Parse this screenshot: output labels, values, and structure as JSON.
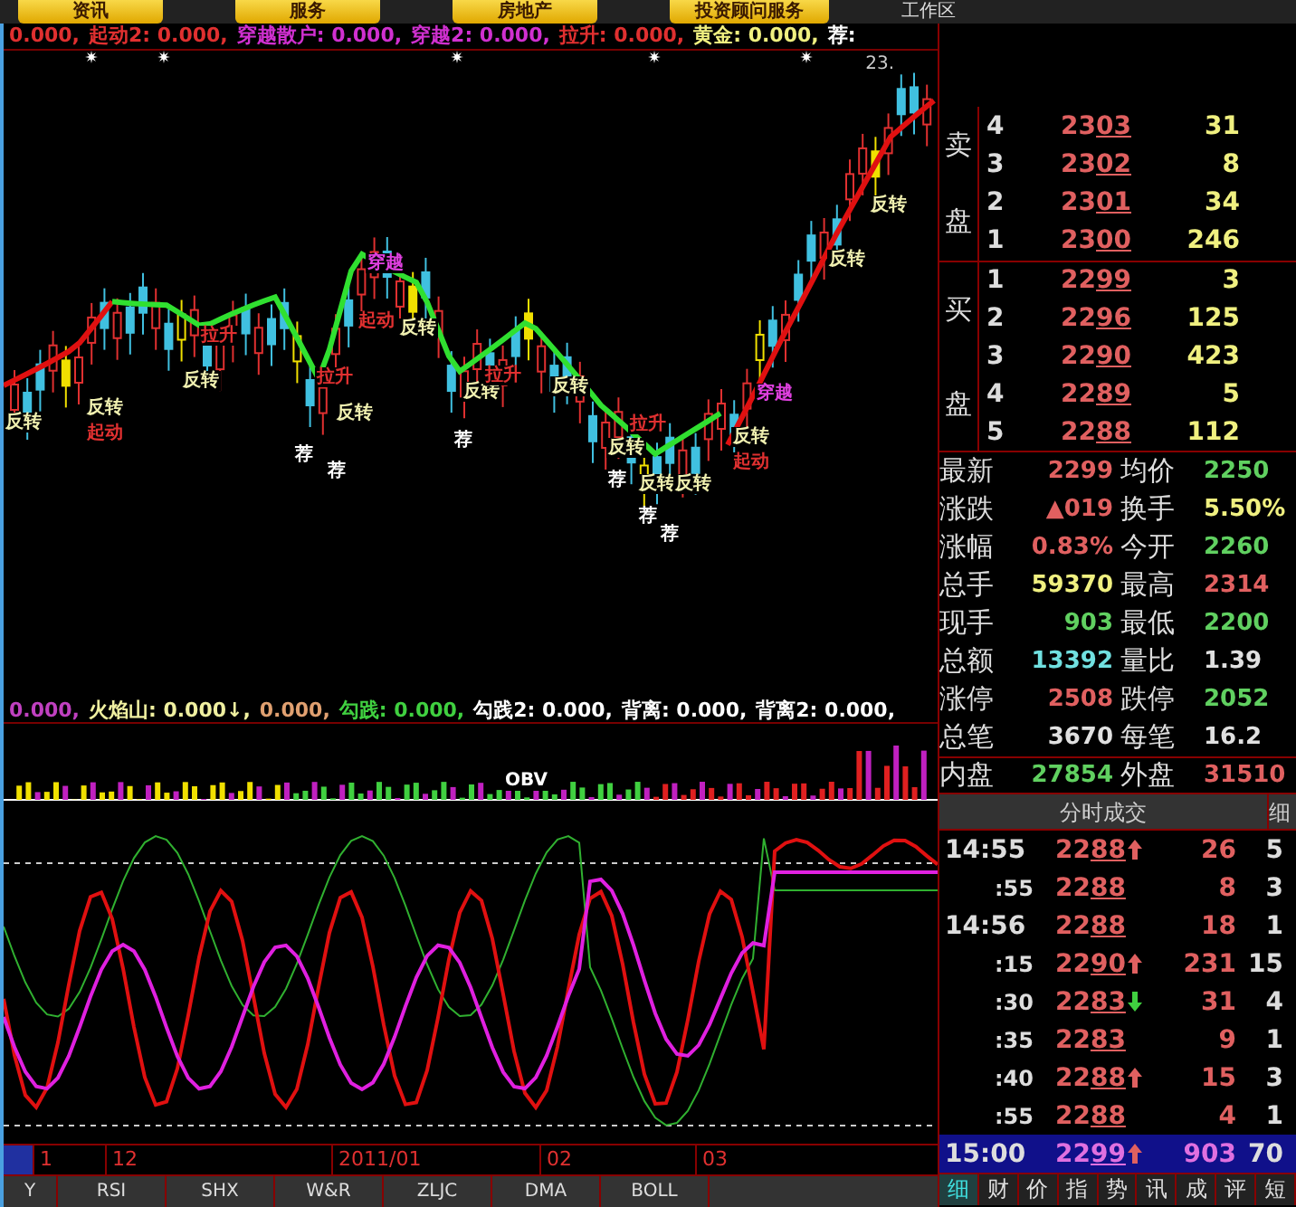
{
  "top_menu": [
    {
      "label": "资讯"
    },
    {
      "label": "服务"
    },
    {
      "label": "房地产"
    },
    {
      "label": "投资顾问服务"
    }
  ],
  "workspace": {
    "label": "工作区"
  },
  "main_legend": [
    {
      "text": "0.000,",
      "color": "#e03030"
    },
    {
      "text": "起动2: 0.000,",
      "color": "#e03030"
    },
    {
      "text": "穿越散户: 0.000,",
      "color": "#d030d0"
    },
    {
      "text": "穿越2: 0.000,",
      "color": "#d030d0"
    },
    {
      "text": "拉升: 0.000,",
      "color": "#e03030"
    },
    {
      "text": "黄金: 0.000,",
      "color": "#f0f080"
    },
    {
      "text": "荐:",
      "color": "#ffffff"
    }
  ],
  "price_tick": "23.",
  "chart_labels": [
    {
      "text": "反转",
      "color": "#f0f0b0"
    },
    {
      "text": "反转",
      "color": "#f0f0b0"
    },
    {
      "text": "起动",
      "color": "#e03030"
    },
    {
      "text": "拉升",
      "color": "#e03030"
    },
    {
      "text": "反转",
      "color": "#f0f0b0"
    },
    {
      "text": "拉升",
      "color": "#e03030"
    },
    {
      "text": "反转",
      "color": "#f0f0b0"
    },
    {
      "text": "荐",
      "color": "#ffffff"
    },
    {
      "text": "荐",
      "color": "#ffffff"
    },
    {
      "text": "穿越",
      "color": "#e040e0"
    },
    {
      "text": "起动",
      "color": "#e03030"
    },
    {
      "text": "反转",
      "color": "#f0f0b0"
    },
    {
      "text": "荐",
      "color": "#ffffff"
    },
    {
      "text": "反转",
      "color": "#f0f0b0"
    },
    {
      "text": "拉升",
      "color": "#e03030"
    },
    {
      "text": "反转",
      "color": "#f0f0b0"
    },
    {
      "text": "拉升",
      "color": "#e03030"
    },
    {
      "text": "反转",
      "color": "#f0f0b0"
    },
    {
      "text": "荐",
      "color": "#ffffff"
    },
    {
      "text": "反转",
      "color": "#f0f0b0"
    },
    {
      "text": "反转",
      "color": "#f0f0b0"
    },
    {
      "text": "荐",
      "color": "#ffffff"
    },
    {
      "text": "荐",
      "color": "#ffffff"
    },
    {
      "text": "反转",
      "color": "#f0f0b0"
    },
    {
      "text": "起动",
      "color": "#e03030"
    },
    {
      "text": "穿越",
      "color": "#e040e0"
    },
    {
      "text": "反转",
      "color": "#f0f0b0"
    },
    {
      "text": "反转",
      "color": "#f0f0b0"
    }
  ],
  "sub_legend": [
    {
      "text": "0.000,",
      "color": "#c040c0"
    },
    {
      "text": "火焰山: 0.000↓,",
      "color": "#f0f0a0"
    },
    {
      "text": "0.000,",
      "color": "#e0a070"
    },
    {
      "text": "勾践: 0.000,",
      "color": "#40d040"
    },
    {
      "text": "勾践2: 0.000,",
      "color": "#ffffff"
    },
    {
      "text": "背离: 0.000,",
      "color": "#ffffff"
    },
    {
      "text": "背离2: 0.000,",
      "color": "#ffffff"
    }
  ],
  "sub_chart_label": "OBV",
  "date_axis": [
    "1",
    "12",
    "2011/01",
    "02",
    "03"
  ],
  "indicator_tabs": [
    {
      "label": "Y"
    },
    {
      "label": "RSI"
    },
    {
      "label": "SHX"
    },
    {
      "label": "W&R"
    },
    {
      "label": "ZLJC"
    },
    {
      "label": "DMA"
    },
    {
      "label": "BOLL"
    }
  ],
  "order_book": {
    "sell_label": [
      "卖",
      "盘"
    ],
    "buy_label": [
      "买",
      "盘"
    ],
    "sell": [
      {
        "level": "4",
        "price": "2303",
        "volume": "31"
      },
      {
        "level": "3",
        "price": "2302",
        "volume": "8"
      },
      {
        "level": "2",
        "price": "2301",
        "volume": "34"
      },
      {
        "level": "1",
        "price": "2300",
        "volume": "246"
      }
    ],
    "buy": [
      {
        "level": "1",
        "price": "2299",
        "volume": "3"
      },
      {
        "level": "2",
        "price": "2296",
        "volume": "125"
      },
      {
        "level": "3",
        "price": "2290",
        "volume": "423"
      },
      {
        "level": "4",
        "price": "2289",
        "volume": "5"
      },
      {
        "level": "5",
        "price": "2288",
        "volume": "112"
      }
    ]
  },
  "stats": [
    [
      {
        "label": "最新",
        "value": "2299",
        "color": "#e06060"
      },
      {
        "label": "均价",
        "value": "2250",
        "color": "#60d060"
      }
    ],
    [
      {
        "label": "涨跌",
        "value": "▲019",
        "color": "#e06060"
      },
      {
        "label": "换手",
        "value": "5.50%",
        "color": "#f0f080"
      }
    ],
    [
      {
        "label": "涨幅",
        "value": "0.83%",
        "color": "#e06060"
      },
      {
        "label": "今开",
        "value": "2260",
        "color": "#60d060"
      }
    ],
    [
      {
        "label": "总手",
        "value": "59370",
        "color": "#f0f080"
      },
      {
        "label": "最高",
        "value": "2314",
        "color": "#e06060"
      }
    ],
    [
      {
        "label": "现手",
        "value": "903",
        "color": "#60d060"
      },
      {
        "label": "最低",
        "value": "2200",
        "color": "#60d060"
      }
    ],
    [
      {
        "label": "总额",
        "value": "13392",
        "color": "#70e0e0"
      },
      {
        "label": "量比",
        "value": "1.39",
        "color": "#e0e0e0"
      }
    ],
    [
      {
        "label": "涨停",
        "value": "2508",
        "color": "#e06060"
      },
      {
        "label": "跌停",
        "value": "2052",
        "color": "#60d060"
      }
    ],
    [
      {
        "label": "总笔",
        "value": "3670",
        "color": "#e0e0e0"
      },
      {
        "label": "每笔",
        "value": "16.2",
        "color": "#e0e0e0"
      }
    ],
    [
      {
        "label": "内盘",
        "value": "27854",
        "color": "#60d060"
      },
      {
        "label": "外盘",
        "value": "31510",
        "color": "#e06060"
      }
    ]
  ],
  "trades_header": {
    "title": "分时成交",
    "tab": "细"
  },
  "trades": [
    {
      "time": "14:55",
      "price": "2288",
      "kind": "up",
      "volume": "26",
      "count": "5",
      "selected": false
    },
    {
      "time": ":55",
      "price": "2288",
      "kind": "none",
      "volume": "8",
      "count": "3",
      "selected": false
    },
    {
      "time": "14:56",
      "price": "2288",
      "kind": "none",
      "volume": "18",
      "count": "1",
      "selected": false
    },
    {
      "time": ":15",
      "price": "2290",
      "kind": "up",
      "volume": "231",
      "count": "15",
      "selected": false
    },
    {
      "time": ":30",
      "price": "2283",
      "kind": "down",
      "volume": "31",
      "count": "4",
      "selected": false
    },
    {
      "time": ":35",
      "price": "2283",
      "kind": "none",
      "volume": "9",
      "count": "1",
      "selected": false
    },
    {
      "time": ":40",
      "price": "2288",
      "kind": "up",
      "volume": "15",
      "count": "3",
      "selected": false
    },
    {
      "time": ":55",
      "price": "2288",
      "kind": "none",
      "volume": "4",
      "count": "1",
      "selected": false
    },
    {
      "time": "15:00",
      "price": "2299",
      "kind": "up",
      "volume": "903",
      "count": "70",
      "selected": true
    }
  ],
  "bottom_tabs": [
    {
      "label": "细",
      "selected": true
    },
    {
      "label": "财",
      "selected": false
    },
    {
      "label": "价",
      "selected": false
    },
    {
      "label": "指",
      "selected": false
    },
    {
      "label": "势",
      "selected": false
    },
    {
      "label": "讯",
      "selected": false
    },
    {
      "label": "成",
      "selected": false
    },
    {
      "label": "评",
      "selected": false
    },
    {
      "label": "短",
      "selected": false
    }
  ]
}
